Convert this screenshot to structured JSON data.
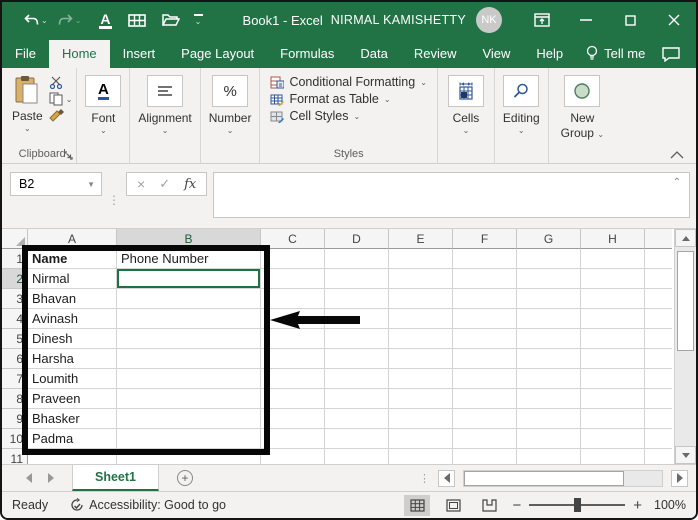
{
  "colors": {
    "excel_green": "#217346",
    "selection_border": "#1e7145",
    "annotation_black": "#070707"
  },
  "titlebar": {
    "title": "Book1  -  Excel",
    "user": "NIRMAL KAMISHETTY",
    "avatar_initials": "NK",
    "qat_icons": [
      "undo-icon",
      "redo-icon",
      "font-color-icon",
      "borders-icon",
      "open-folder-icon",
      "customize-qat-icon"
    ],
    "window_icons": [
      "ribbon-display-options-icon",
      "minimize-icon",
      "maximize-icon",
      "close-icon"
    ]
  },
  "ribbon_tabs": {
    "tabs": [
      {
        "label": "File",
        "selected": false
      },
      {
        "label": "Home",
        "selected": true
      },
      {
        "label": "Insert",
        "selected": false
      },
      {
        "label": "Page Layout",
        "selected": false
      },
      {
        "label": "Formulas",
        "selected": false
      },
      {
        "label": "Data",
        "selected": false
      },
      {
        "label": "Review",
        "selected": false
      },
      {
        "label": "View",
        "selected": false
      },
      {
        "label": "Help",
        "selected": false
      }
    ],
    "tell_me": "Tell me"
  },
  "ribbon": {
    "clipboard": {
      "label": "Clipboard",
      "paste": "Paste"
    },
    "font": {
      "label": "Font"
    },
    "alignment": {
      "label": "Alignment"
    },
    "number": {
      "label": "Number"
    },
    "styles": {
      "label": "Styles",
      "items": [
        "Conditional Formatting",
        "Format as Table",
        "Cell Styles"
      ]
    },
    "cells": {
      "label": "Cells"
    },
    "editing": {
      "label": "Editing"
    },
    "new_group": {
      "line1": "New",
      "line2": "Group"
    }
  },
  "formula_bar": {
    "name_box": "B2",
    "fx": "fx",
    "formula": ""
  },
  "grid": {
    "columns": [
      "A",
      "B",
      "C",
      "D",
      "E",
      "F",
      "G",
      "H"
    ],
    "selected_cell": "B2",
    "selected_column": "B",
    "selected_row": 2,
    "rows": [
      {
        "n": 1,
        "A": "Name",
        "B": "Phone Number",
        "bold_a": true
      },
      {
        "n": 2,
        "A": "Nirmal",
        "B": ""
      },
      {
        "n": 3,
        "A": "Bhavan",
        "B": ""
      },
      {
        "n": 4,
        "A": "Avinash",
        "B": ""
      },
      {
        "n": 5,
        "A": "Dinesh",
        "B": ""
      },
      {
        "n": 6,
        "A": "Harsha",
        "B": ""
      },
      {
        "n": 7,
        "A": "Loumith",
        "B": ""
      },
      {
        "n": 8,
        "A": "Praveen",
        "B": ""
      },
      {
        "n": 9,
        "A": "Bhasker",
        "B": ""
      },
      {
        "n": 10,
        "A": "Padma",
        "B": ""
      },
      {
        "n": 11,
        "A": "",
        "B": ""
      }
    ]
  },
  "sheet_bar": {
    "active_tab": "Sheet1",
    "add_label": "+"
  },
  "status_bar": {
    "ready": "Ready",
    "accessibility": "Accessibility: Good to go",
    "zoom_level": "100%"
  }
}
